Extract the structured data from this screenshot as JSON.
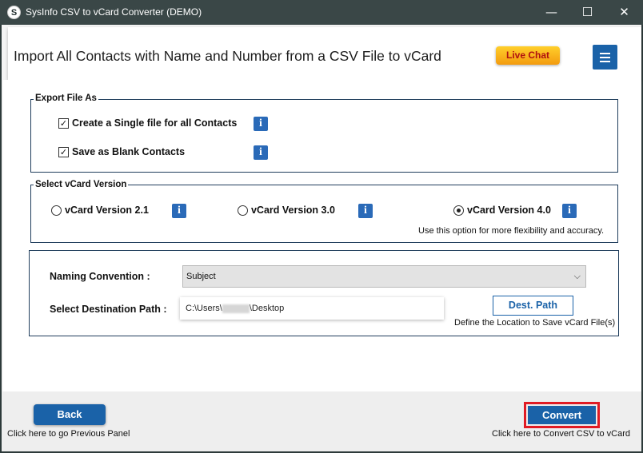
{
  "window": {
    "logo_letter": "S",
    "title": "SysInfo CSV to vCard Converter (DEMO)",
    "minimize_glyph": "—",
    "maximize_glyph": "☐",
    "close_glyph": "✕"
  },
  "header": {
    "headline": "Import All Contacts with Name and Number from a CSV File to vCard",
    "live_chat_label": "Live Chat",
    "menu_icon": "hamburger-menu-icon"
  },
  "export_as": {
    "legend": "Export File As",
    "options": [
      {
        "label": "Create a Single file for all Contacts",
        "checked": true
      },
      {
        "label": "Save as Blank Contacts",
        "checked": true
      }
    ]
  },
  "vcard_version": {
    "legend": "Select vCard Version",
    "options": [
      {
        "label": "vCard Version 2.1",
        "selected": false
      },
      {
        "label": "vCard Version 3.0",
        "selected": false
      },
      {
        "label": "vCard Version 4.0",
        "selected": true
      }
    ],
    "hint": "Use this option for more flexibility and accuracy."
  },
  "output": {
    "naming_label": "Naming Convention :",
    "naming_value": "Subject",
    "dest_label": "Select Destination Path :",
    "dest_path_prefix": "C:\\Users\\",
    "dest_path_suffix": "\\Desktop",
    "dest_button": "Dest. Path",
    "dest_hint": "Define the Location to Save vCard File(s)"
  },
  "footer": {
    "back_label": "Back",
    "back_hint": "Click here to go Previous Panel",
    "convert_label": "Convert",
    "convert_hint": "Click here to Convert CSV to vCard"
  },
  "icons": {
    "info_glyph": "i",
    "check_glyph": "✓",
    "dropdown_glyph": "⌵"
  },
  "colors": {
    "accent": "#1a62a8",
    "live_chat": "#f5a623",
    "highlight": "#e01b24"
  }
}
